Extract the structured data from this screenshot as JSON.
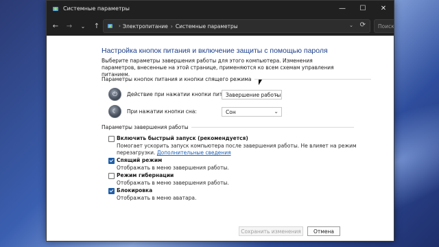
{
  "window": {
    "title": "Системные параметры",
    "controls": {
      "minimize": "—",
      "maximize": "☐",
      "close": "✕"
    }
  },
  "nav": {
    "back": "←",
    "forward": "→",
    "history": "⌄",
    "up": "↑"
  },
  "address": {
    "breadcrumbs": [
      "Электропитание",
      "Системные параметры"
    ],
    "separator": "›",
    "dropdown": "⌄",
    "refresh": "⟳"
  },
  "search": {
    "placeholder": "Поиск в панели...",
    "icon": "⌕"
  },
  "page": {
    "title": "Настройка кнопок питания и включение защиты с помощью пароля",
    "description": "Выберите параметры завершения работы для этого компьютера. Изменения параметров, внесенные на этой странице, применяются ко всем схемам управления питанием."
  },
  "power_section": {
    "heading": "Параметры кнопок питания и кнопки спящего режима",
    "rows": [
      {
        "label": "Действие при нажатии кнопки питания:",
        "value": "Завершение работы",
        "icon": "power-button-icon"
      },
      {
        "label": "При нажатии кнопки сна:",
        "value": "Сон",
        "icon": "sleep-button-icon"
      }
    ]
  },
  "shutdown_section": {
    "heading": "Параметры завершения работы",
    "items": [
      {
        "label": "Включить быстрый запуск (рекомендуется)",
        "checked": false,
        "desc_line1": "Помогает ускорить запуск компьютера после завершения работы. Не влияет на режим",
        "desc_line2": "перезагрузки.",
        "link": "Дополнительные сведения"
      },
      {
        "label": "Спящий режим",
        "checked": true,
        "desc_line1": "Отображать в меню завершения работы."
      },
      {
        "label": "Режим гибернации",
        "checked": false,
        "desc_line1": "Отображать в меню завершения работы."
      },
      {
        "label": "Блокировка",
        "checked": true,
        "desc_line1": "Отображать в меню аватара."
      }
    ]
  },
  "footer": {
    "save": "Сохранить изменения",
    "cancel": "Отмена"
  },
  "colors": {
    "title_blue": "#1c3e8a",
    "link_blue": "#1b5fb8",
    "checkbox_blue": "#1f5ea8",
    "titlebar": "#202020"
  }
}
